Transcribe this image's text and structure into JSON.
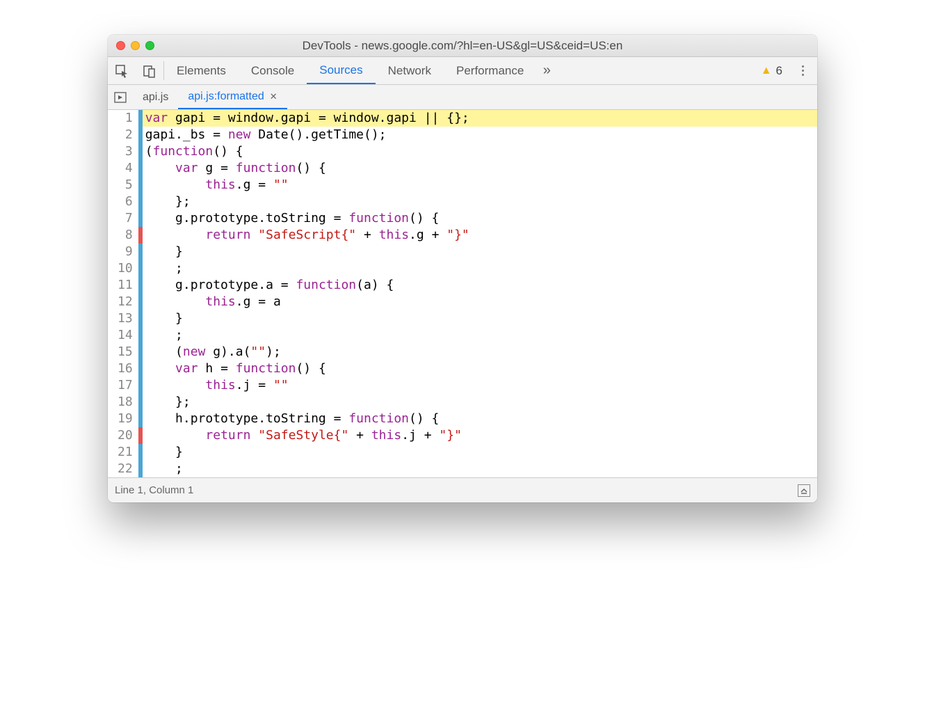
{
  "window": {
    "title": "DevTools - news.google.com/?hl=en-US&gl=US&ceid=US:en"
  },
  "tabs": {
    "elements": "Elements",
    "console": "Console",
    "sources": "Sources",
    "network": "Network",
    "performance": "Performance"
  },
  "warnings": {
    "count": "6"
  },
  "fileTabs": {
    "tab1": "api.js",
    "tab2": "api.js:formatted"
  },
  "marks": [
    "blue",
    "blue",
    "blue",
    "blue",
    "blue",
    "blue",
    "blue",
    "red",
    "blue",
    "blue",
    "blue",
    "blue",
    "blue",
    "blue",
    "blue",
    "blue",
    "blue",
    "blue",
    "blue",
    "red",
    "blue",
    "blue"
  ],
  "code": {
    "lines": [
      {
        "n": "1",
        "html": "<span class='kw'>var</span> gapi <span class='op'>=</span> window.gapi <span class='op'>=</span> window.gapi <span class='op'>||</span> {};",
        "hl": true
      },
      {
        "n": "2",
        "html": "gapi._bs <span class='op'>=</span> <span class='kw'>new</span> Date().getTime();"
      },
      {
        "n": "3",
        "html": "(<span class='kw'>function</span>() {"
      },
      {
        "n": "4",
        "html": "    <span class='kw'>var</span> g <span class='op'>=</span> <span class='kw'>function</span>() {"
      },
      {
        "n": "5",
        "html": "        <span class='kw'>this</span>.g <span class='op'>=</span> <span class='str'>\"\"</span>"
      },
      {
        "n": "6",
        "html": "    };"
      },
      {
        "n": "7",
        "html": "    g.prototype.toString <span class='op'>=</span> <span class='kw'>function</span>() {"
      },
      {
        "n": "8",
        "html": "        <span class='kw'>return</span> <span class='str'>\"SafeScript{\"</span> <span class='op'>+</span> <span class='kw'>this</span>.g <span class='op'>+</span> <span class='str'>\"}\"</span>"
      },
      {
        "n": "9",
        "html": "    }"
      },
      {
        "n": "10",
        "html": "    ;"
      },
      {
        "n": "11",
        "html": "    g.prototype.a <span class='op'>=</span> <span class='kw'>function</span>(a) {"
      },
      {
        "n": "12",
        "html": "        <span class='kw'>this</span>.g <span class='op'>=</span> a"
      },
      {
        "n": "13",
        "html": "    }"
      },
      {
        "n": "14",
        "html": "    ;"
      },
      {
        "n": "15",
        "html": "    (<span class='kw'>new</span> g).a(<span class='str'>\"\"</span>);"
      },
      {
        "n": "16",
        "html": "    <span class='kw'>var</span> h <span class='op'>=</span> <span class='kw'>function</span>() {"
      },
      {
        "n": "17",
        "html": "        <span class='kw'>this</span>.j <span class='op'>=</span> <span class='str'>\"\"</span>"
      },
      {
        "n": "18",
        "html": "    };"
      },
      {
        "n": "19",
        "html": "    h.prototype.toString <span class='op'>=</span> <span class='kw'>function</span>() {"
      },
      {
        "n": "20",
        "html": "        <span class='kw'>return</span> <span class='str'>\"SafeStyle{\"</span> <span class='op'>+</span> <span class='kw'>this</span>.j <span class='op'>+</span> <span class='str'>\"}\"</span>"
      },
      {
        "n": "21",
        "html": "    }"
      },
      {
        "n": "22",
        "html": "    ;"
      }
    ]
  },
  "status": {
    "position": "Line 1, Column 1"
  }
}
